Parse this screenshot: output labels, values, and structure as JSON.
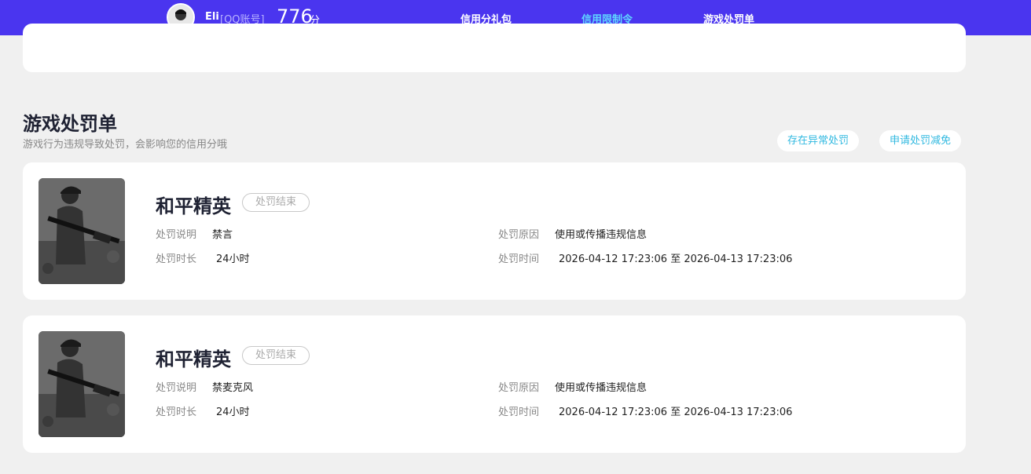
{
  "header": {
    "user_name": "Eli",
    "account_type": "[QQ账号]",
    "score": "776",
    "score_unit": "分",
    "nav": [
      {
        "label": "信用分礼包",
        "active": false
      },
      {
        "label": "信用限制令",
        "active": true
      },
      {
        "label": "游戏处罚单",
        "active": false
      }
    ],
    "accent_color": "#4a35ef",
    "active_color": "#5fd6ff"
  },
  "section": {
    "title": "游戏处罚单",
    "subtitle": "游戏行为违规导致处罚，会影响您的信用分哦",
    "buttons": {
      "abnormal": "存在异常处罚",
      "reduce": "申请处罚减免"
    }
  },
  "labels": {
    "desc": "处罚说明",
    "reason": "处罚原因",
    "duration": "处罚时长",
    "time": "处罚时间"
  },
  "records": [
    {
      "game": "和平精英",
      "status": "处罚结束",
      "desc": "禁言",
      "reason": "使用或传播违规信息",
      "duration": "24小时",
      "time": "2026-04-12 17:23:06 至 2026-04-13 17:23:06"
    },
    {
      "game": "和平精英",
      "status": "处罚结束",
      "desc": "禁麦克风",
      "reason": "使用或传播违规信息",
      "duration": "24小时",
      "time": "2026-04-12 17:23:06 至 2026-04-13 17:23:06"
    }
  ]
}
